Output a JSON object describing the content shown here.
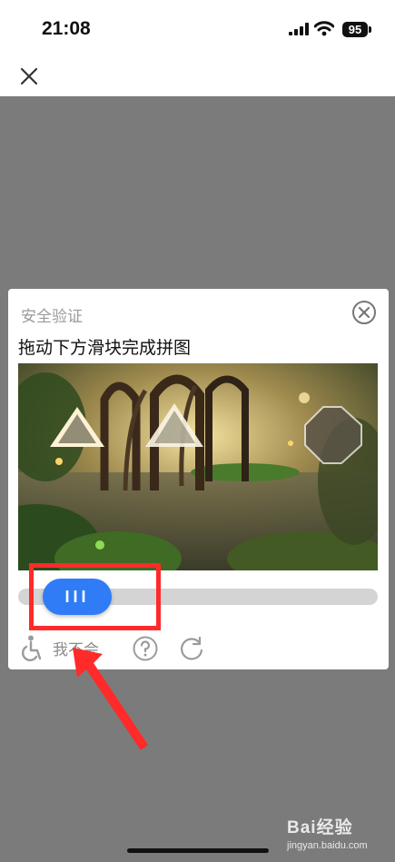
{
  "status_bar": {
    "time": "21:08",
    "battery": "95"
  },
  "dialog": {
    "title": "安全验证",
    "instruction": "拖动下方滑块完成拼图",
    "slider_knob_label": "III",
    "cant_do_label": "我不会"
  },
  "icons": {
    "close": "close-icon",
    "dialog_close": "circle-close-icon",
    "accessibility": "accessibility-icon",
    "help": "question-circle-icon",
    "refresh": "refresh-icon"
  },
  "watermark": {
    "main": "Bai经验",
    "sub": "jingyan.baidu.com"
  },
  "colors": {
    "accent": "#2f7cf6",
    "annotation": "#ff2a2a",
    "overlay": "#7b7b7b"
  }
}
